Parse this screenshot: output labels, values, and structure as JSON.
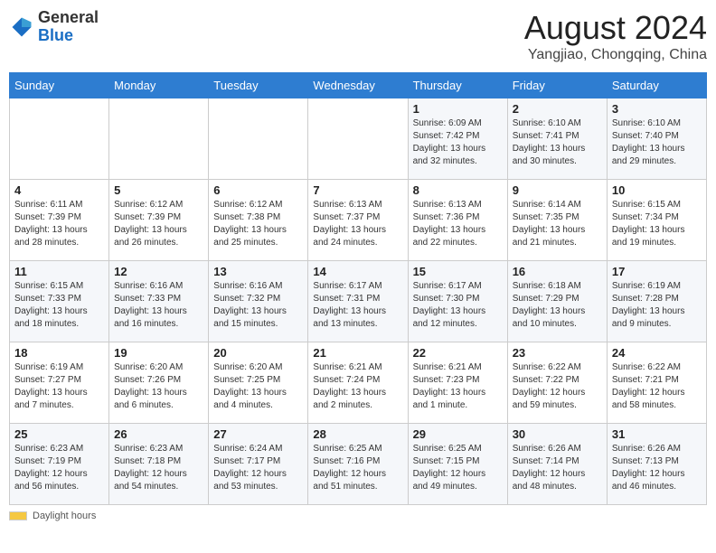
{
  "header": {
    "logo_general": "General",
    "logo_blue": "Blue",
    "month_year": "August 2024",
    "location": "Yangjiao, Chongqing, China"
  },
  "weekdays": [
    "Sunday",
    "Monday",
    "Tuesday",
    "Wednesday",
    "Thursday",
    "Friday",
    "Saturday"
  ],
  "weeks": [
    [
      {
        "day": "",
        "info": ""
      },
      {
        "day": "",
        "info": ""
      },
      {
        "day": "",
        "info": ""
      },
      {
        "day": "",
        "info": ""
      },
      {
        "day": "1",
        "info": "Sunrise: 6:09 AM\nSunset: 7:42 PM\nDaylight: 13 hours and 32 minutes."
      },
      {
        "day": "2",
        "info": "Sunrise: 6:10 AM\nSunset: 7:41 PM\nDaylight: 13 hours and 30 minutes."
      },
      {
        "day": "3",
        "info": "Sunrise: 6:10 AM\nSunset: 7:40 PM\nDaylight: 13 hours and 29 minutes."
      }
    ],
    [
      {
        "day": "4",
        "info": "Sunrise: 6:11 AM\nSunset: 7:39 PM\nDaylight: 13 hours and 28 minutes."
      },
      {
        "day": "5",
        "info": "Sunrise: 6:12 AM\nSunset: 7:39 PM\nDaylight: 13 hours and 26 minutes."
      },
      {
        "day": "6",
        "info": "Sunrise: 6:12 AM\nSunset: 7:38 PM\nDaylight: 13 hours and 25 minutes."
      },
      {
        "day": "7",
        "info": "Sunrise: 6:13 AM\nSunset: 7:37 PM\nDaylight: 13 hours and 24 minutes."
      },
      {
        "day": "8",
        "info": "Sunrise: 6:13 AM\nSunset: 7:36 PM\nDaylight: 13 hours and 22 minutes."
      },
      {
        "day": "9",
        "info": "Sunrise: 6:14 AM\nSunset: 7:35 PM\nDaylight: 13 hours and 21 minutes."
      },
      {
        "day": "10",
        "info": "Sunrise: 6:15 AM\nSunset: 7:34 PM\nDaylight: 13 hours and 19 minutes."
      }
    ],
    [
      {
        "day": "11",
        "info": "Sunrise: 6:15 AM\nSunset: 7:33 PM\nDaylight: 13 hours and 18 minutes."
      },
      {
        "day": "12",
        "info": "Sunrise: 6:16 AM\nSunset: 7:33 PM\nDaylight: 13 hours and 16 minutes."
      },
      {
        "day": "13",
        "info": "Sunrise: 6:16 AM\nSunset: 7:32 PM\nDaylight: 13 hours and 15 minutes."
      },
      {
        "day": "14",
        "info": "Sunrise: 6:17 AM\nSunset: 7:31 PM\nDaylight: 13 hours and 13 minutes."
      },
      {
        "day": "15",
        "info": "Sunrise: 6:17 AM\nSunset: 7:30 PM\nDaylight: 13 hours and 12 minutes."
      },
      {
        "day": "16",
        "info": "Sunrise: 6:18 AM\nSunset: 7:29 PM\nDaylight: 13 hours and 10 minutes."
      },
      {
        "day": "17",
        "info": "Sunrise: 6:19 AM\nSunset: 7:28 PM\nDaylight: 13 hours and 9 minutes."
      }
    ],
    [
      {
        "day": "18",
        "info": "Sunrise: 6:19 AM\nSunset: 7:27 PM\nDaylight: 13 hours and 7 minutes."
      },
      {
        "day": "19",
        "info": "Sunrise: 6:20 AM\nSunset: 7:26 PM\nDaylight: 13 hours and 6 minutes."
      },
      {
        "day": "20",
        "info": "Sunrise: 6:20 AM\nSunset: 7:25 PM\nDaylight: 13 hours and 4 minutes."
      },
      {
        "day": "21",
        "info": "Sunrise: 6:21 AM\nSunset: 7:24 PM\nDaylight: 13 hours and 2 minutes."
      },
      {
        "day": "22",
        "info": "Sunrise: 6:21 AM\nSunset: 7:23 PM\nDaylight: 13 hours and 1 minute."
      },
      {
        "day": "23",
        "info": "Sunrise: 6:22 AM\nSunset: 7:22 PM\nDaylight: 12 hours and 59 minutes."
      },
      {
        "day": "24",
        "info": "Sunrise: 6:22 AM\nSunset: 7:21 PM\nDaylight: 12 hours and 58 minutes."
      }
    ],
    [
      {
        "day": "25",
        "info": "Sunrise: 6:23 AM\nSunset: 7:19 PM\nDaylight: 12 hours and 56 minutes."
      },
      {
        "day": "26",
        "info": "Sunrise: 6:23 AM\nSunset: 7:18 PM\nDaylight: 12 hours and 54 minutes."
      },
      {
        "day": "27",
        "info": "Sunrise: 6:24 AM\nSunset: 7:17 PM\nDaylight: 12 hours and 53 minutes."
      },
      {
        "day": "28",
        "info": "Sunrise: 6:25 AM\nSunset: 7:16 PM\nDaylight: 12 hours and 51 minutes."
      },
      {
        "day": "29",
        "info": "Sunrise: 6:25 AM\nSunset: 7:15 PM\nDaylight: 12 hours and 49 minutes."
      },
      {
        "day": "30",
        "info": "Sunrise: 6:26 AM\nSunset: 7:14 PM\nDaylight: 12 hours and 48 minutes."
      },
      {
        "day": "31",
        "info": "Sunrise: 6:26 AM\nSunset: 7:13 PM\nDaylight: 12 hours and 46 minutes."
      }
    ]
  ],
  "footer": {
    "daylight_label": "Daylight hours"
  }
}
